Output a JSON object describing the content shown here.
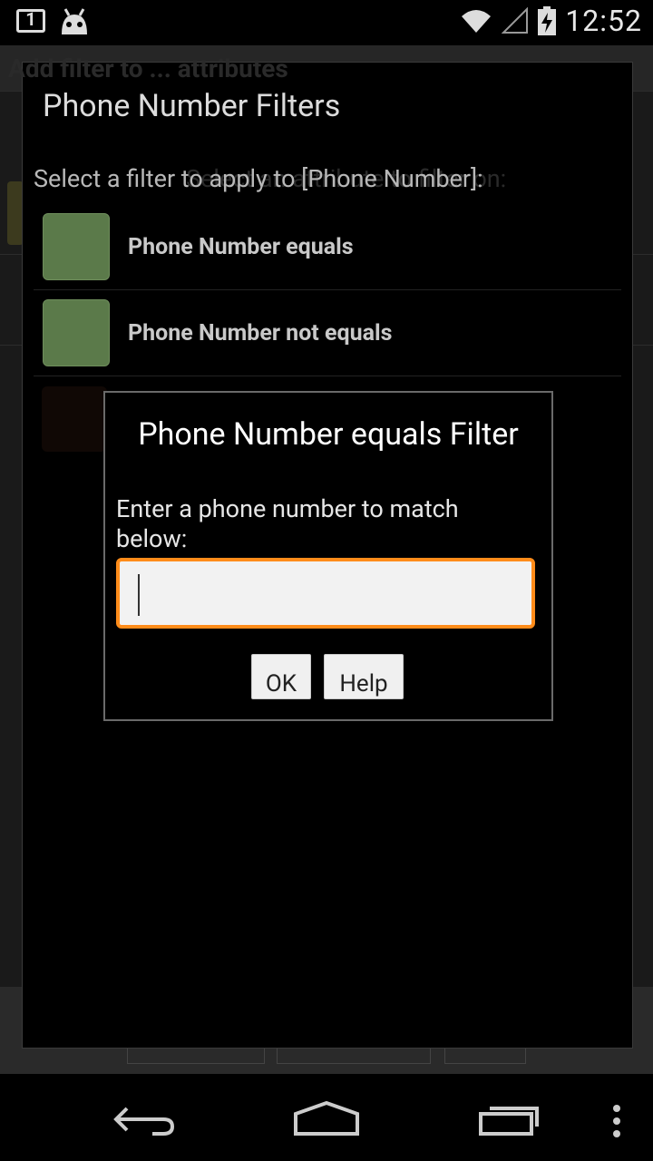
{
  "status_bar": {
    "notification_count": "1",
    "time": "12:52"
  },
  "behind": {
    "ghost_title": "Add filter to ... attributes",
    "ghost_sub": "Select an attribute to filter on:"
  },
  "filter_list": {
    "title": "Phone Number Filters",
    "subtitle": "Select a filter to apply to [Phone Number]:",
    "items": [
      {
        "label": "Phone Number equals"
      },
      {
        "label": "Phone Number not equals"
      }
    ]
  },
  "dialog": {
    "title": "Phone Number equals Filter",
    "message": "Enter a phone number to match below:",
    "input_value": "",
    "ok_label": "OK",
    "help_label": "Help"
  },
  "colors": {
    "accent": "#ff8c1a",
    "swatch": "#5b7a4a"
  },
  "nav": {
    "back": "back-icon",
    "home": "home-icon",
    "recents": "recents-icon",
    "menu": "overflow-menu-icon"
  }
}
